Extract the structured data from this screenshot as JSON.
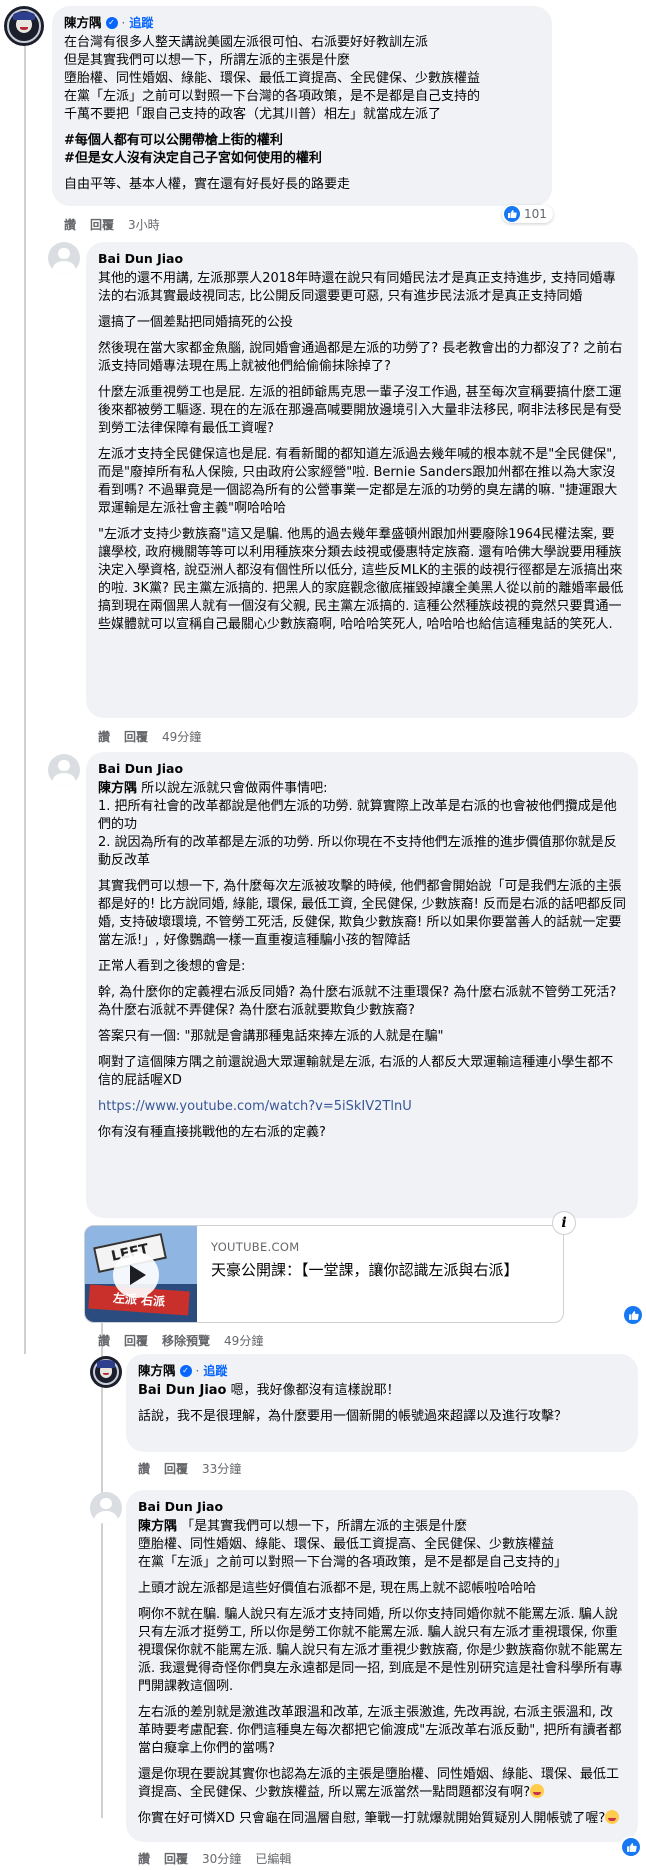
{
  "labels": {
    "follow": "追蹤",
    "like": "讚",
    "reply": "回覆",
    "remove_preview": "移除預覽",
    "edited": "已編輯"
  },
  "colors": {
    "link": "#385898",
    "accent": "#0866ff",
    "bubble": "#f0f2f5"
  },
  "c1": {
    "author": "陳方隅",
    "verified_icon": "verified-badge",
    "paragraphs": [
      "在台灣有很多人整天講說美國左派很可怕、右派要好好教訓左派\n但是其實我們可以想一下，所謂左派的主張是什麼\n墮胎權、同性婚姻、綠能、環保、最低工資提高、全民健保、少數族權益\n在黨「左派」之前可以對照一下台灣的各項政策，是不是都是自己支持的\n千萬不要把「跟自己支持的政客（尤其川普）相左」就當成左派了"
    ],
    "bold_lines": [
      "#每個人都有可以公開帶槍上街的權利",
      "#但是女人沒有決定自己子宮如何使用的權利"
    ],
    "closing": "自由平等、基本人權，實在還有好長好長的路要走",
    "time": "3小時",
    "reactions": "101"
  },
  "c2": {
    "author": "Bai Dun Jiao",
    "paragraphs": [
      "其他的還不用講, 左派那票人2018年時還在說只有同婚民法才是真正支持進步, 支持同婚專法的右派其實最歧視同志, 比公開反同還要更可惡, 只有進步民法派才是真正支持同婚",
      "還搞了一個差點把同婚搞死的公投",
      "然後現在當大家都金魚腦, 說同婚會通過都是左派的功勞了? 長老教會出的力都沒了? 之前右派支持同婚專法現在馬上就被他們給偷偷抹除掉了?",
      "什麼左派重視勞工也是屁. 左派的祖師爺馬克思一輩子沒工作過, 甚至每次宣稱要搞什麼工運後來都被勞工驅逐. 現在的左派在那邊高喊要開放邊境引入大量非法移民, 啊非法移民是有受到勞工法律保障有最低工資喔?",
      "左派才支持全民健保這也是屁. 有看新聞的都知道左派過去幾年喊的根本就不是\"全民健保\", 而是\"廢掉所有私人保險, 只由政府公家經營\"啦. Bernie Sanders跟加州都在推以為大家沒看到嗎? 不過畢竟是一個認為所有的公營事業一定都是左派的功勞的臭左講的嘛. \"捷運跟大眾運輸是左派社會主義\"啊哈哈哈",
      "\"左派才支持少數族裔\"這又是騙. 他馬的過去幾年羣盛頓州跟加州要廢除1964民權法案, 要讓學校, 政府機關等等可以利用種族來分類去歧視或優惠特定族裔. 還有哈佛大學說要用種族決定入學資格, 說亞洲人都沒有個性所以低分, 這些反MLK的主張的歧視行徑都是左派搞出來的啦. 3K黨? 民主黨左派搞的. 把黑人的家庭觀念徹底摧毀掉讓全美黑人從以前的離婚率最低搞到現在兩個黑人就有一個沒有父親, 民主黨左派搞的. 這種公然種族歧視的竟然只要貫通一些媒體就可以宣稱自己最關心少數族裔啊, 哈哈哈笑死人, 哈哈哈也給信這種鬼話的笑死人."
    ],
    "time": "49分鐘"
  },
  "c3": {
    "author": "Bai Dun Jiao",
    "mention": "陳方隅",
    "first": " 所以說左派就只會做兩件事情吧:\n1. 把所有社會的改革都說是他們左派的功勞. 就算實際上改革是右派的也會被他們攬成是他們的功\n2. 說因為所有的改革都是左派的功勞. 所以你現在不支持他們左派推的進步價值那你就是反動反改革",
    "paragraphs": [
      "其實我們可以想一下, 為什麼每次左派被攻擊的時候, 他們都會開始說「可是我們左派的主張都是好的! 比方說同婚, 綠能, 環保, 最低工資, 全民健保, 少數族裔! 反而是右派的話吧都反同婚, 支持破壞環境, 不管勞工死活, 反健保, 欺負少數族裔! 所以如果你要當善人的話就一定要當左派!」, 好像鸚鵡一樣一直重複這種騙小孩的智障話",
      "正常人看到之後想的會是:",
      "幹, 為什麼你的定義裡右派反同婚? 為什麼右派就不注重環保? 為什麼右派就不管勞工死活? 為什麼右派就不弄健保? 為什麼右派就要欺負少數族裔?",
      "答案只有一個: \"那就是會講那種鬼話來捧左派的人就是在騙\"",
      "啊對了這個陳方隅之前還說過大眾運輸就是左派, 右派的人都反大眾運輸這種連小學生都不信的屁話喔XD"
    ],
    "link": "https://www.youtube.com/watch?v=5iSkIV2TlnU",
    "question": "你有沒有種直接挑戰他的左右派的定義?",
    "preview_domain": "YOUTUBE.COM",
    "preview_title": "天豪公開課：【一堂課，讓你認識左派與右派】",
    "preview_sign1": "LEFT",
    "preview_sign2": "左派 右派",
    "time": "49分鐘"
  },
  "c4": {
    "author": "陳方隅",
    "mention": "Bai Dun Jiao",
    "first": " 嗯，我好像都沒有這樣說耶！",
    "second": "話說，我不是很理解，為什麼要用一個新開的帳號過來超譯以及進行攻擊？",
    "time": "33分鐘"
  },
  "c5": {
    "author": "Bai Dun Jiao",
    "mention": "陳方隅",
    "first": " 「是其實我們可以想一下，所謂左派的主張是什麼\n墮胎權、同性婚姻、綠能、環保、最低工資提高、全民健保、少數族權益\n在黨「左派」之前可以對照一下台灣的各項政策，是不是都是自己支持的」",
    "paragraphs": [
      "上頭才說左派都是這些好價值右派都不是, 現在馬上就不認帳啦哈哈哈",
      "啊你不就在騙. 騙人說只有左派才支持同婚, 所以你支持同婚你就不能罵左派. 騙人說只有左派才挺勞工, 所以你是勞工你就不能罵左派. 騙人說只有左派才重視環保, 你重視環保你就不能罵左派. 騙人說只有左派才重視少數族裔, 你是少數族裔你就不能罵左派. 我還覺得奇怪你們臭左永遠都是同一招, 到底是不是性別研究這是社會科學所有專門開課教這個咧.",
      "左右派的差別就是激進改革跟溫和改革, 左派主張激進, 先改再說, 右派主張溫和, 改革時要考慮配套. 你們這種臭左每次都把它偷渡成\"左派改革右派反動\", 把所有讀者都當白癡拿上你們的當嗎?",
      "還是你現在要說其實你也認為左派的主張是墮胎權、同性婚姻、綠能、環保、最低工資提高、全民健保、少數族權益, 所以罵左派當然一點問題都沒有啊?"
    ],
    "last": "你實在好可憐XD 只會龜在同溫層自慰, 筆戰一打就爆就開始質疑別人開帳號了喔?",
    "time": "30分鐘"
  }
}
